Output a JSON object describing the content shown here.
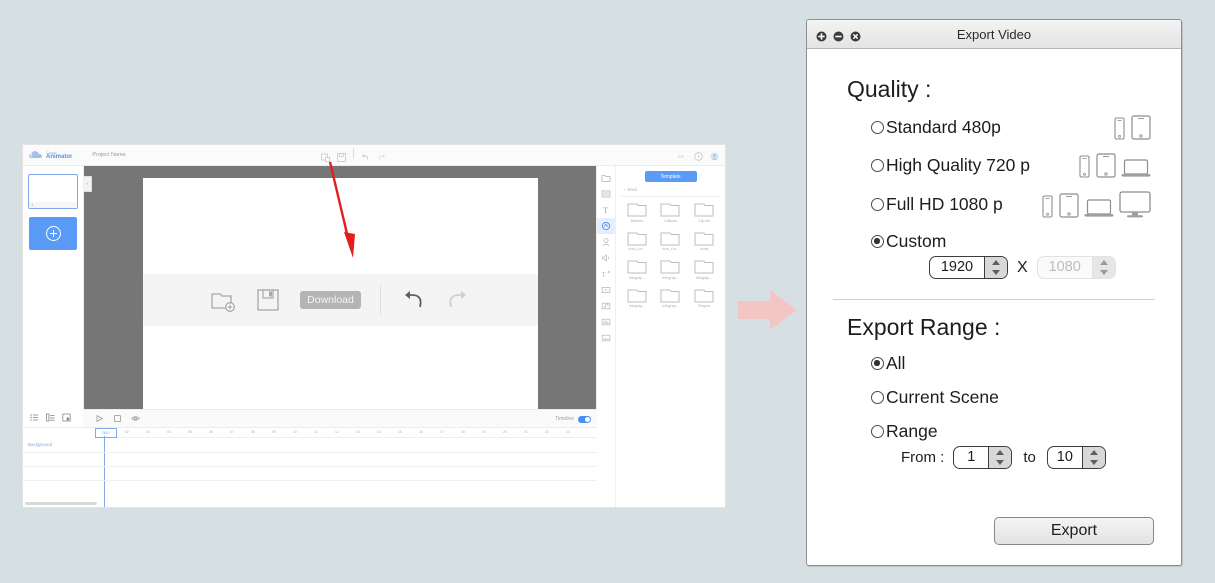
{
  "editor": {
    "logo": {
      "line1": "Cloud",
      "line2": "Animator",
      "icon": "cloud-icon"
    },
    "project_name": "Project Name",
    "topbar_icons": [
      "new-file-icon",
      "save-icon",
      "undo-icon",
      "redo-icon"
    ],
    "topbar_right_icons": [
      "language-en-icon",
      "info-icon",
      "account-avatar-icon"
    ],
    "scene": {
      "number": "1",
      "add_label": "+"
    },
    "float_toolbar": {
      "icons": [
        "folder-add-icon",
        "save-disk-icon"
      ],
      "download_label": "Download",
      "undo_icon": "undo-arrow-icon",
      "redo_icon": "redo-arrow-icon"
    },
    "timeline": {
      "label": "Timeline",
      "playhead": "00.0",
      "track_label": "Background",
      "ticks": [
        "01",
        "02",
        "03",
        "04",
        "05",
        "06",
        "07",
        "08",
        "09",
        "10",
        "11",
        "12",
        "13",
        "14",
        "15",
        "16",
        "17",
        "18",
        "19",
        "20",
        "21",
        "22",
        "23"
      ],
      "controls": [
        "play-icon",
        "stop-icon",
        "eye-icon"
      ],
      "tools": [
        "list-icon",
        "outline-icon",
        "group-icon"
      ]
    },
    "asset_panel": {
      "tab_label": "Template",
      "back_label": "Back",
      "folders": [
        "Buttons",
        "Callouts",
        "Clip Art",
        "Icon_Lin...",
        "Icon_Lin...",
        "Icons",
        "Infograp...",
        "Infograp...",
        "Infograp...",
        "Infograp...",
        "Infograp...",
        "Shapes"
      ],
      "vertical_tools": [
        "folder-icon",
        "list-icon",
        "text-icon",
        "shapes-icon",
        "character-icon",
        "audio-icon",
        "text-add-icon",
        "video-icon",
        "music-icon",
        "chart-icon",
        "image-icon"
      ]
    }
  },
  "arrows": {
    "red_annotation": "red-arrow-down",
    "pink_flow": "pink-arrow-right"
  },
  "dialog": {
    "title": "Export Video",
    "window_buttons": [
      "maximize-button",
      "minimize-button",
      "close-button"
    ],
    "quality": {
      "heading": "Quality :",
      "options": [
        {
          "label": "Standard 480p",
          "selected": false,
          "devices": [
            "phone",
            "tablet"
          ]
        },
        {
          "label": "High Quality 720 p",
          "selected": false,
          "devices": [
            "phone",
            "tablet",
            "laptop"
          ]
        },
        {
          "label": "Full HD 1080 p",
          "selected": false,
          "devices": [
            "phone",
            "tablet",
            "laptop",
            "desktop"
          ]
        },
        {
          "label": "Custom",
          "selected": true,
          "devices": []
        }
      ],
      "custom_width": "1920",
      "custom_height": "1080",
      "separator": "X"
    },
    "export_range": {
      "heading": "Export Range :",
      "options": [
        {
          "label": "All",
          "selected": true
        },
        {
          "label": "Current Scene",
          "selected": false
        },
        {
          "label": "Range",
          "selected": false
        }
      ],
      "from_label": "From :",
      "from_value": "1",
      "to_label": "to",
      "to_value": "10"
    },
    "export_button": "Export"
  },
  "colors": {
    "background": "#d6e0e3",
    "accent_blue": "#5b9bf8",
    "pink_arrow": "#f3c5c5",
    "red_arrow": "#e51c1c"
  }
}
